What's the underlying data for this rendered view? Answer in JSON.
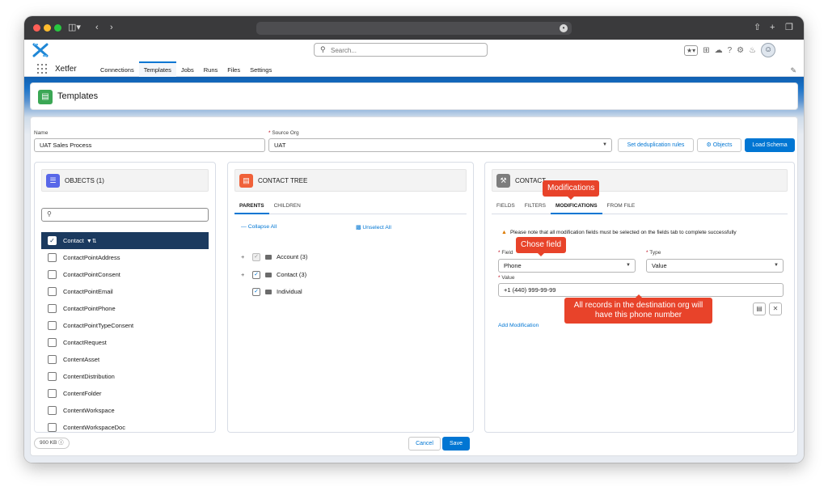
{
  "header": {
    "app_name": "Xetfer",
    "search_placeholder": "Search...",
    "nav_tabs": [
      "Connections",
      "Templates",
      "Jobs",
      "Runs",
      "Files",
      "Settings"
    ],
    "active_tab": "Templates"
  },
  "page": {
    "title": "Templates"
  },
  "form": {
    "name_label": "Name",
    "name_value": "UAT Sales Process",
    "source_org_label": "Source Org",
    "source_org_value": "UAT",
    "btn_dedup": "Set deduplication rules",
    "btn_objects": "Objects",
    "btn_load_schema": "Load Schema"
  },
  "objects_panel": {
    "title": "OBJECTS",
    "count": "(1)",
    "items": [
      {
        "label": "Contact",
        "checked": true,
        "selected": true
      },
      {
        "label": "ContactPointAddress",
        "checked": false
      },
      {
        "label": "ContactPointConsent",
        "checked": false
      },
      {
        "label": "ContactPointEmail",
        "checked": false
      },
      {
        "label": "ContactPointPhone",
        "checked": false
      },
      {
        "label": "ContactPointTypeConsent",
        "checked": false
      },
      {
        "label": "ContactRequest",
        "checked": false
      },
      {
        "label": "ContentAsset",
        "checked": false
      },
      {
        "label": "ContentDistribution",
        "checked": false
      },
      {
        "label": "ContentFolder",
        "checked": false
      },
      {
        "label": "ContentWorkspace",
        "checked": false
      },
      {
        "label": "ContentWorkspaceDoc",
        "checked": false
      }
    ]
  },
  "tree_panel": {
    "title": "CONTACT TREE",
    "tabs": [
      "PARENTS",
      "CHILDREN"
    ],
    "collapse_all": "Collapse All",
    "unselect_all": "Unselect All",
    "rows": [
      {
        "label": "Account (3)",
        "expandable": true,
        "checked": true,
        "disabled": true
      },
      {
        "label": "Contact (3)",
        "expandable": true,
        "checked": true,
        "disabled": false
      },
      {
        "label": "Individual",
        "expandable": false,
        "checked": true,
        "disabled": false
      }
    ]
  },
  "contact_panel": {
    "title": "CONTACT",
    "tabs": [
      "FIELDS",
      "FILTERS",
      "MODIFICATIONS",
      "FROM FILE"
    ],
    "active_tab": "MODIFICATIONS",
    "warning": "Please note that all modification fields must be selected on the fields tab to complete successfully",
    "field_label": "Field",
    "field_value": "Phone",
    "type_label": "Type",
    "type_value": "Value",
    "value_label": "Value",
    "value_value": "+1 (440) 999-99-99",
    "add_modification": "Add Modification"
  },
  "callouts": {
    "modifications": "Modifications",
    "chose_field": "Chose field",
    "destination_note": "All records in the destination org will have this phone number"
  },
  "footer": {
    "size_badge": "900 KB",
    "cancel": "Cancel",
    "save": "Save"
  },
  "colors": {
    "brand": "#0176d3",
    "callout": "#e8432a",
    "selected_row": "#1b3a5f",
    "templates_icon": "#3ba755",
    "objects_icon": "#5867e8",
    "tree_icon": "#f06139",
    "contact_icon": "#7d7d7d"
  }
}
